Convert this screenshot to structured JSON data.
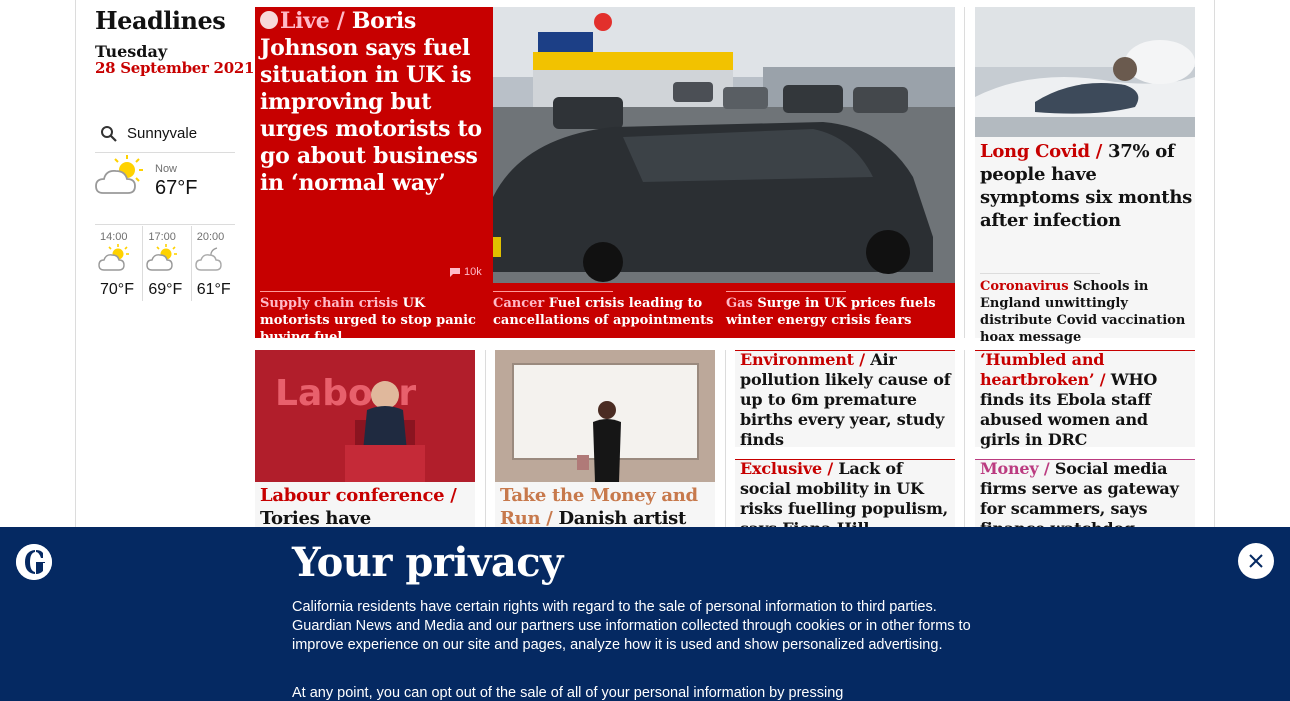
{
  "colors": {
    "news_red": "#c70000",
    "banner_blue": "#052962",
    "kicker_pink": "#ffbac8",
    "money_pink": "#bb3b80",
    "culture_orange": "#c7794c"
  },
  "sidebar": {
    "title": "Headlines",
    "day": "Tuesday",
    "date": "28 September 2021",
    "weather": {
      "location": "Sunnyvale",
      "now_label": "Now",
      "now_temp": "67°F",
      "forecast": [
        {
          "time": "14:00",
          "temp": "70°F",
          "icon": "partly-sunny-icon"
        },
        {
          "time": "17:00",
          "temp": "69°F",
          "icon": "partly-sunny-icon"
        },
        {
          "time": "20:00",
          "temp": "61°F",
          "icon": "cloudy-night-icon"
        }
      ]
    }
  },
  "main": {
    "kicker": "Live /",
    "headline": "Boris Johnson says fuel situation in UK is improving but urges motorists to go about business in ‘normal way’",
    "comments": "10k",
    "sublinks": [
      {
        "kicker": "Supply chain crisis",
        "text": "UK motorists urged to stop panic buying fuel"
      },
      {
        "kicker": "Cancer",
        "text": "Fuel crisis leading to cancellations of appointments"
      },
      {
        "kicker": "Gas",
        "text": "Surge in UK prices fuels winter energy crisis fears"
      }
    ]
  },
  "right_top": {
    "kicker": "Long Covid /",
    "headline": "37% of people have symptoms six months after infection",
    "sub_kicker": "Coronavirus",
    "sub_text": "Schools in England unwittingly distribute Covid vaccination hoax message"
  },
  "row2": {
    "labour": {
      "kicker": "Labour conference /",
      "headline": "Tories have ‘defunded"
    },
    "art": {
      "kicker": "Take the Money and Run /",
      "headline": "Danish artist"
    },
    "environment": {
      "kicker": "Environment /",
      "headline": "Air pollution likely cause of up to 6m premature births every year, study finds"
    },
    "exclusive": {
      "kicker": "Exclusive /",
      "headline": "Lack of social mobility in UK risks fuelling populism, says Fiona Hill"
    },
    "ebola": {
      "kicker": "‘Humbled and heartbroken’ /",
      "headline": "WHO finds its Ebola staff abused women and girls in DRC"
    },
    "money": {
      "kicker": "Money /",
      "headline": "Social media firms serve as gateway for scammers, says finance watchdog"
    }
  },
  "privacy": {
    "title": "Your privacy",
    "text": "California residents have certain rights with regard to the sale of personal information to third parties. Guardian News and Media and our partners use information collected through cookies or in other forms to improve experience on our site and pages, analyze how it is used and show personalized advertising.",
    "text2": "At any point, you can opt out of the sale of all of your personal information by pressing"
  }
}
